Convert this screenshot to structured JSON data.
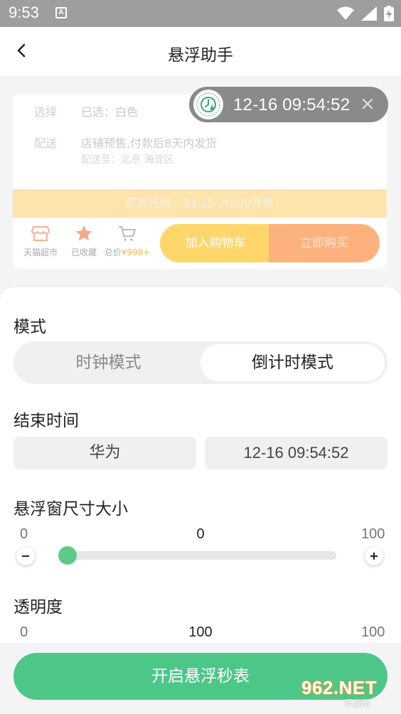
{
  "status_bar": {
    "time": "9:53",
    "notification_glyph": "A"
  },
  "top_bar": {
    "title": "悬浮助手"
  },
  "preview": {
    "select_label": "选择",
    "select_value": "已选：白色",
    "delivery_label": "配送",
    "delivery_value": "店铺预售,付款后8天内发货",
    "delivery_sub": "配送至：北京 海淀区",
    "banner": "即将开始，03.15 20:00开售",
    "dock": {
      "shop_label": "天猫超市",
      "fav_label": "已收藏",
      "total_label": "总价",
      "total_price": "¥999+",
      "cart_button": "加入购物车",
      "buy_button": "立即购买"
    }
  },
  "float_timer": {
    "time": "12-16 09:54:52"
  },
  "mode": {
    "title": "模式",
    "options": [
      {
        "label": "时钟模式",
        "selected": false
      },
      {
        "label": "倒计时模式",
        "selected": true
      }
    ]
  },
  "end_time": {
    "title": "结束时间",
    "source": "华为",
    "value": "12-16 09:54:52"
  },
  "size": {
    "title": "悬浮窗尺寸大小",
    "min": "0",
    "max": "100",
    "value": "0",
    "level": 0
  },
  "opacity": {
    "title": "透明度",
    "min": "0",
    "max": "100",
    "value": "100"
  },
  "start_button": "开启悬浮秒表",
  "watermark": {
    "main": "962.NET",
    "sub": "乐游网"
  },
  "colors": {
    "accent": "#4dc788",
    "cart": "#fed66b",
    "buy": "#fdb27d",
    "banner": "#fde4ad"
  }
}
